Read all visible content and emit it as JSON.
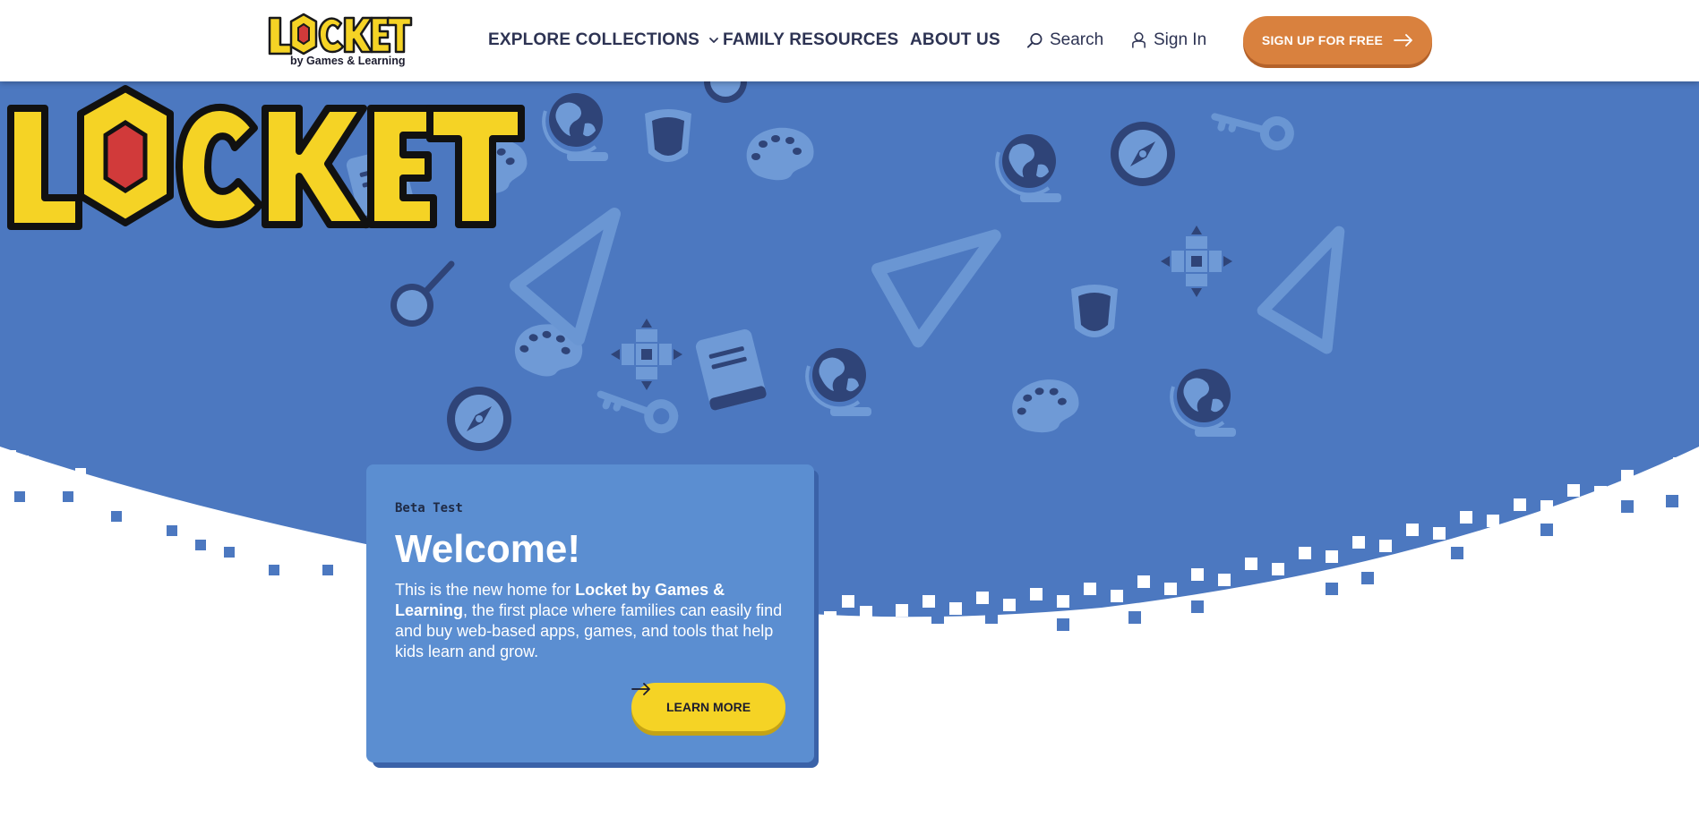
{
  "header": {
    "logo_word": "LOCKET",
    "logo_sub": "by Games & Learning",
    "nav": {
      "explore": "EXPLORE COLLECTIONS",
      "family": "FAMILY RESOURCES",
      "about": "ABOUT US",
      "search": "Search",
      "signin": "Sign In"
    },
    "signup": "SIGN UP FOR FREE"
  },
  "hero": {
    "logo_word": "LOCKET"
  },
  "card": {
    "eyebrow": "Beta Test",
    "title": "Welcome!",
    "body_pre": "This is the new home for ",
    "body_bold": "Locket by Games & Learning",
    "body_post": ", the first place where families can easily find and buy web-based apps, games, and tools that help kids learn and grow.",
    "button": "LEARN MORE"
  },
  "colors": {
    "hero_blue": "#4c78c0",
    "card_blue": "#5b8ed1",
    "brand_yellow": "#f5d325",
    "brand_orange": "#d9813e",
    "lock_red": "#d13a3a",
    "navy": "#2d3353"
  },
  "icons": [
    "chevron-down-icon",
    "search-icon",
    "user-icon",
    "arrow-right-icon",
    "palette-icon",
    "globe-icon",
    "book-icon",
    "magnifier-icon",
    "compass-icon",
    "ruler-triangle-icon",
    "key-icon",
    "dpad-icon",
    "shield-icon"
  ]
}
